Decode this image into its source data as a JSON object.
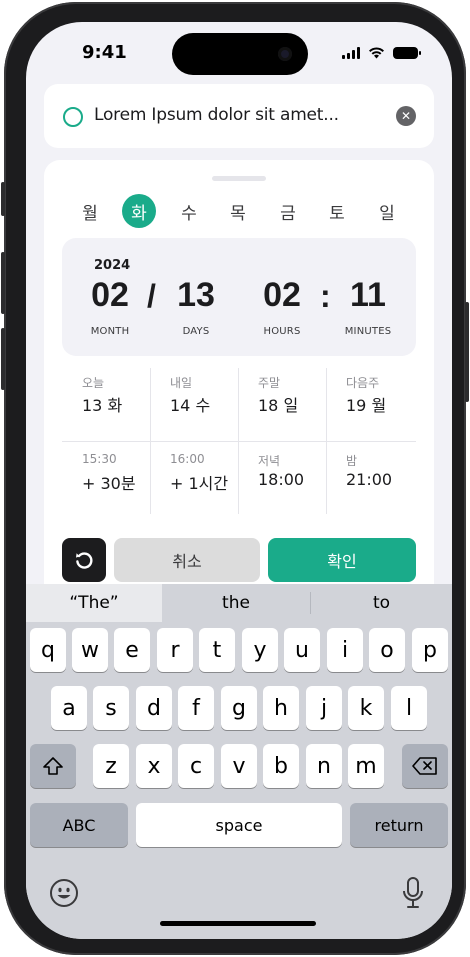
{
  "status_bar": {
    "time": "9:41"
  },
  "task": {
    "text": "Lorem Ipsum dolor sit amet...",
    "accent": "#1aab8a"
  },
  "weekdays": [
    {
      "label": "월",
      "active": false
    },
    {
      "label": "화",
      "active": true
    },
    {
      "label": "수",
      "active": false
    },
    {
      "label": "목",
      "active": false
    },
    {
      "label": "금",
      "active": false
    },
    {
      "label": "토",
      "active": false
    },
    {
      "label": "일",
      "active": false
    }
  ],
  "datetime": {
    "year": "2024",
    "month": "02",
    "month_unit": "MONTH",
    "date_sep": "/",
    "day": "13",
    "day_unit": "DAYS",
    "hour": "02",
    "hour_unit": "HOURS",
    "time_sep": ":",
    "minute": "11",
    "minute_unit": "MINUTES"
  },
  "quick_options": [
    {
      "label": "오늘",
      "value": "13 화"
    },
    {
      "label": "내일",
      "value": "14 수"
    },
    {
      "label": "주말",
      "value": "18 일"
    },
    {
      "label": "다음주",
      "value": "19 월"
    },
    {
      "label": "15:30",
      "value": "+ 30분"
    },
    {
      "label": "16:00",
      "value": "+ 1시간"
    },
    {
      "label": "저녁",
      "value": "18:00"
    },
    {
      "label": "밤",
      "value": "21:00"
    }
  ],
  "actions": {
    "cancel": "취소",
    "confirm": "확인"
  },
  "keyboard": {
    "suggestions": [
      "“The”",
      "the",
      "to"
    ],
    "row1": [
      "q",
      "w",
      "e",
      "r",
      "t",
      "y",
      "u",
      "i",
      "o",
      "p"
    ],
    "row2": [
      "a",
      "s",
      "d",
      "f",
      "g",
      "h",
      "j",
      "k",
      "l"
    ],
    "row3": [
      "z",
      "x",
      "c",
      "v",
      "b",
      "n",
      "m"
    ],
    "abc": "ABC",
    "space": "space",
    "return": "return"
  },
  "colors": {
    "accent": "#1aab8a",
    "sheet_panel": "#f2f2f7",
    "keyboard_bg": "#d1d3d9"
  }
}
